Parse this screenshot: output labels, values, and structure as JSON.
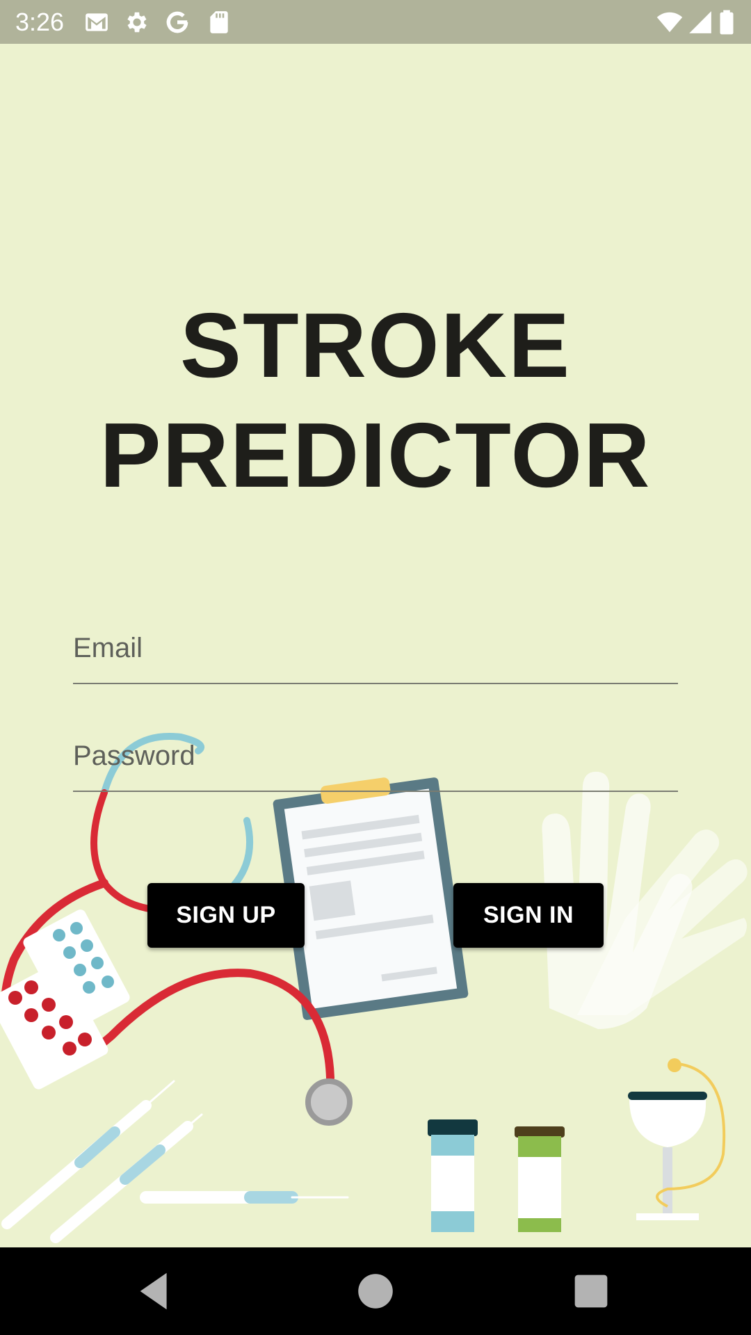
{
  "status_bar": {
    "time": "3:26",
    "left_icons": [
      "gmail-icon",
      "settings-icon",
      "google-icon",
      "sd-card-icon"
    ],
    "right_icons": [
      "wifi-icon",
      "signal-icon",
      "battery-icon"
    ]
  },
  "app": {
    "title_line1": "STROKE",
    "title_line2": "PREDICTOR"
  },
  "form": {
    "email_placeholder": "Email",
    "email_value": "",
    "password_placeholder": "Password",
    "password_value": ""
  },
  "buttons": {
    "sign_up": "SIGN UP",
    "sign_in": "SIGN IN"
  },
  "nav": {
    "back": "back-icon",
    "home": "home-icon",
    "recents": "recents-icon"
  },
  "colors": {
    "background": "#ecf2cf",
    "status_bar": "#b0b39a",
    "button": "#000000",
    "button_text": "#ffffff",
    "title": "#1e1e1a"
  }
}
